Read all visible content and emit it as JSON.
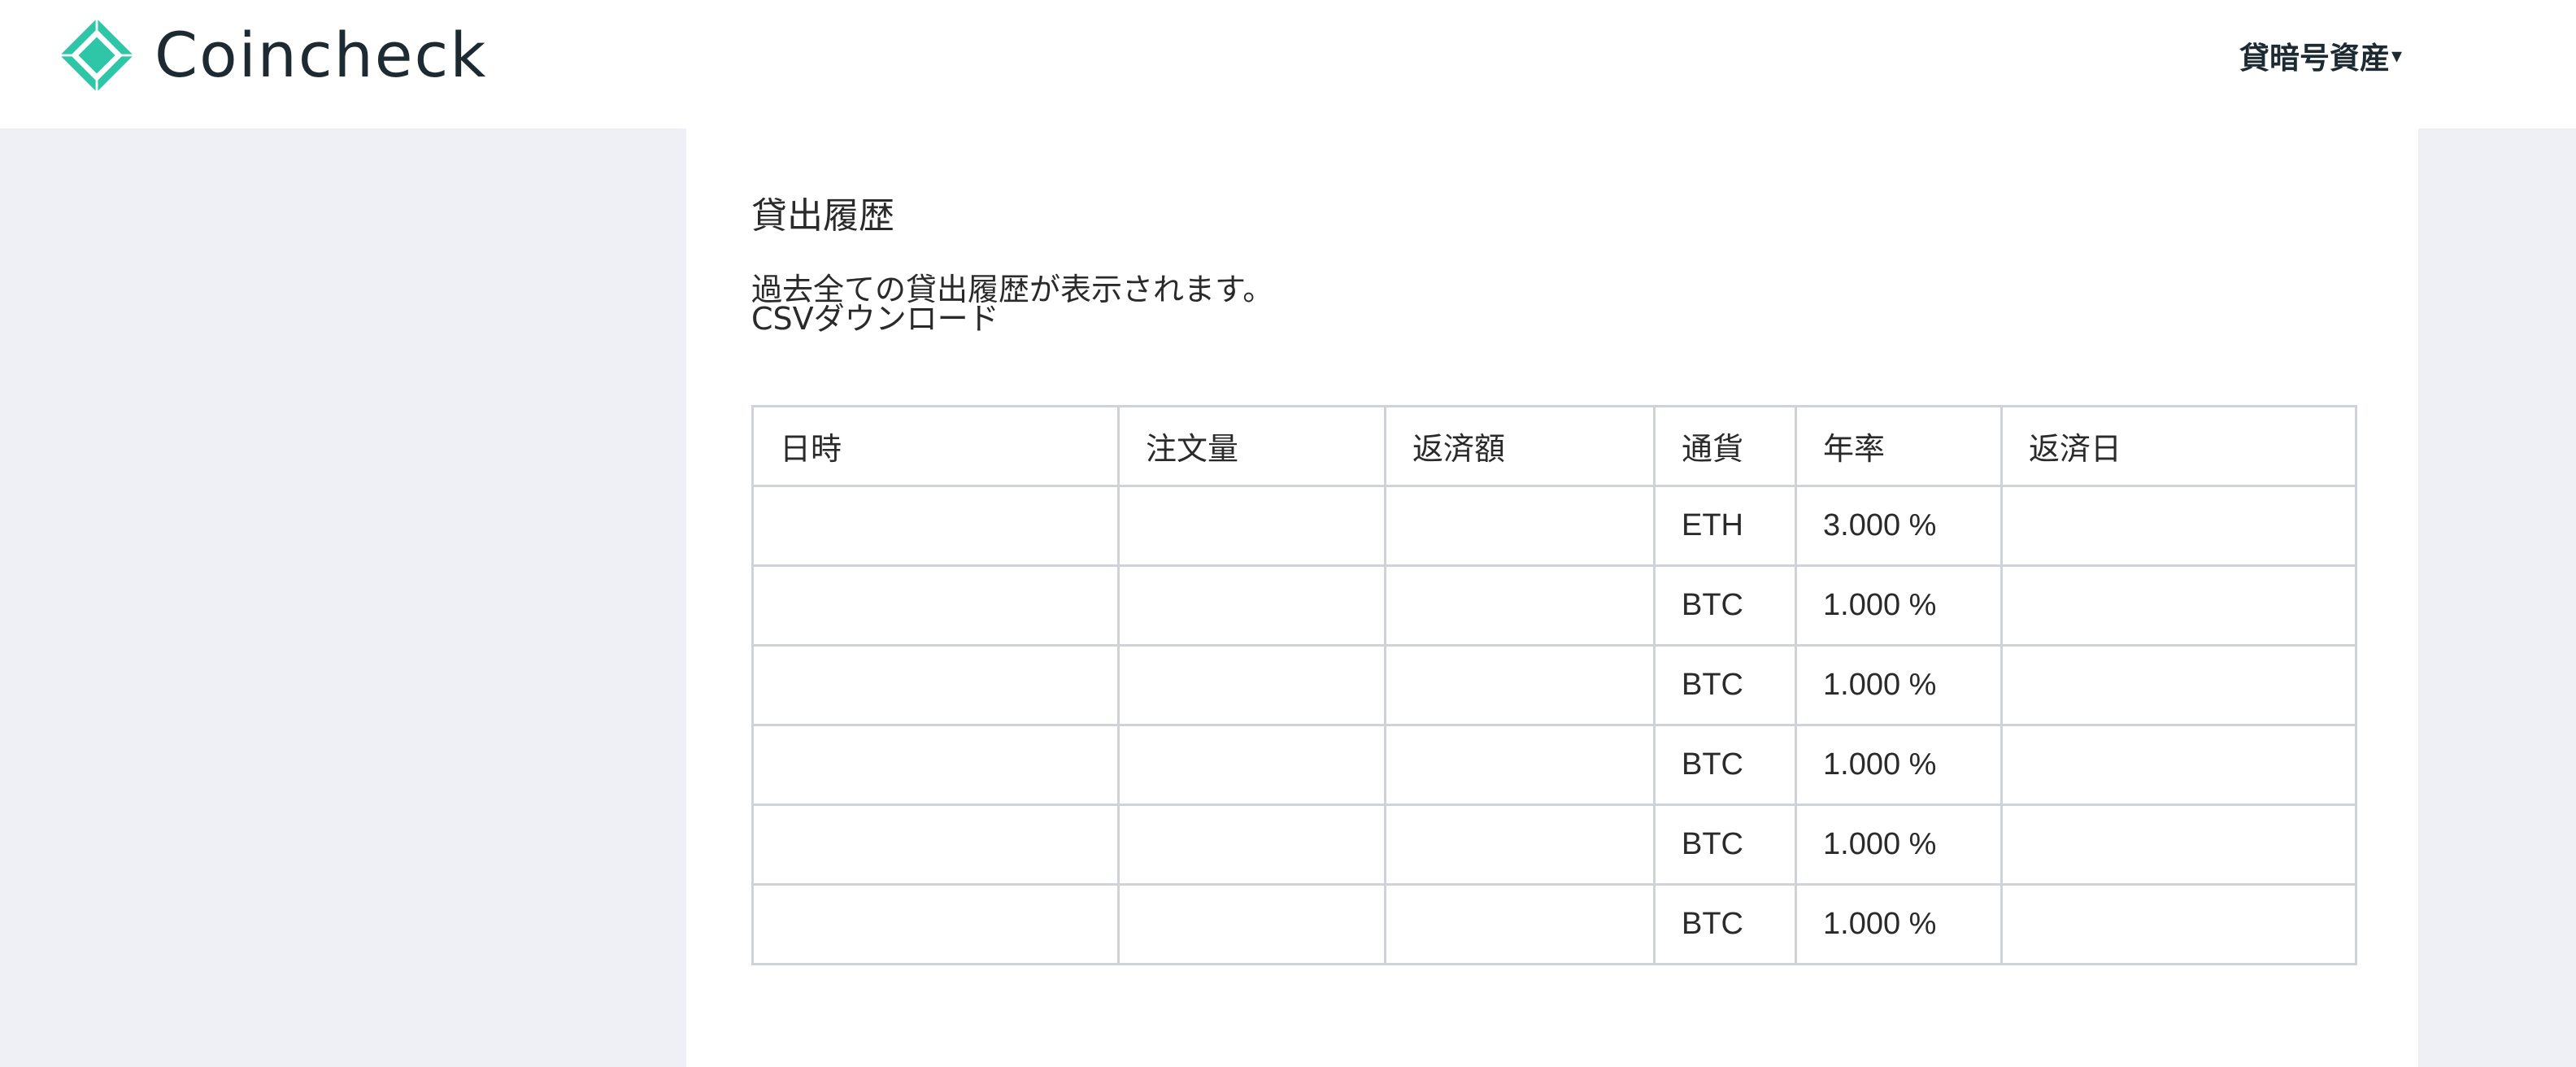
{
  "header": {
    "logo_text": "Coincheck",
    "logo_icon": "coincheck-diamond-logo",
    "brand_color": "#2fc6a8",
    "nav_menu_label": "貸暗号資産",
    "nav_caret": "▾"
  },
  "main": {
    "title": "貸出履歴",
    "description": "過去全ての貸出履歴が表示されます。",
    "csv_link": "CSVダウンロード",
    "table": {
      "headers": [
        "日時",
        "注文量",
        "返済額",
        "通貨",
        "年率",
        "返済日"
      ],
      "rows": [
        {
          "date": "",
          "quantity": "",
          "repayment": "",
          "currency": "ETH",
          "rate": "3.000 %",
          "repay_date": ""
        },
        {
          "date": "",
          "quantity": "",
          "repayment": "",
          "currency": "BTC",
          "rate": "1.000 %",
          "repay_date": ""
        },
        {
          "date": "",
          "quantity": "",
          "repayment": "",
          "currency": "BTC",
          "rate": "1.000 %",
          "repay_date": ""
        },
        {
          "date": "",
          "quantity": "",
          "repayment": "",
          "currency": "BTC",
          "rate": "1.000 %",
          "repay_date": ""
        },
        {
          "date": "",
          "quantity": "",
          "repayment": "",
          "currency": "BTC",
          "rate": "1.000 %",
          "repay_date": ""
        },
        {
          "date": "",
          "quantity": "",
          "repayment": "",
          "currency": "BTC",
          "rate": "1.000 %",
          "repay_date": ""
        }
      ]
    }
  }
}
